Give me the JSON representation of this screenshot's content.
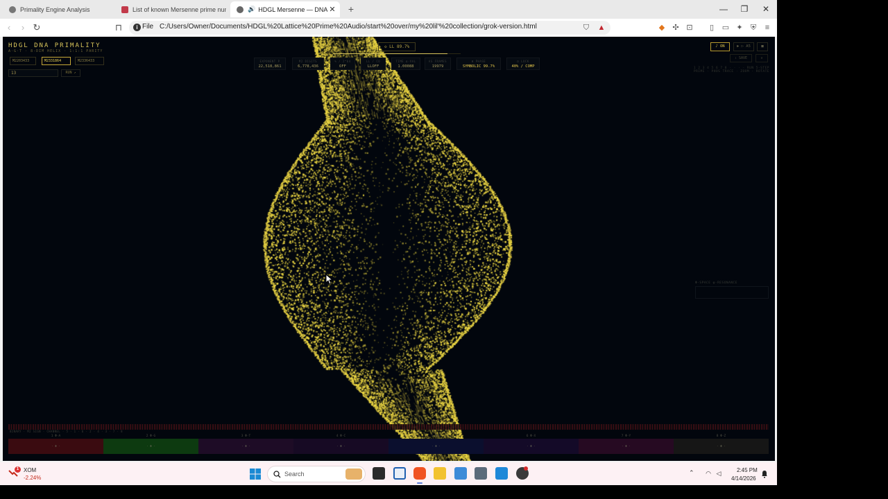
{
  "browser": {
    "tabs": [
      {
        "title": "Primality Engine Analysis",
        "icon": "globe-icon",
        "active": false
      },
      {
        "title": "List of known Mersenne prime numb",
        "icon": "wiki-icon",
        "active": false
      },
      {
        "title": "HDGL Mersenne — DNA Prim",
        "icon": "globe-icon",
        "active": true
      }
    ],
    "new_tab_label": "+",
    "controls": {
      "minimize": "—",
      "restore": "❐",
      "close": "✕"
    },
    "address": {
      "scheme_label": "File",
      "url": "C:/Users/Owner/Documents/HDGL%20Lattice%20Prime%20Audio/start%20over/my%20lil'%20collection/grok-version.html"
    }
  },
  "app": {
    "title": "HDGL DNA PRIMALITY",
    "subtitle": "A·G·T · 8-DIM HELIX · 1:1:1 PARITY",
    "presets": [
      "M2203433",
      "M2331864",
      "M2336433"
    ],
    "active_preset_index": 1,
    "exponent_input": "13",
    "run_label": "RUN ↗",
    "ll_badge": "◇ LL 89.7%",
    "ll_progress": 0.897,
    "stats": [
      {
        "label": "EXPONENT P",
        "value": "22,518,861"
      },
      {
        "label": "M2 DIGITS",
        "value": "6,778,436"
      },
      {
        "label": "% / 2^64",
        "value": "OFF"
      },
      {
        "label": "LL / CO",
        "value": "LLOFF"
      },
      {
        "label": "TIME Δ-VAL",
        "value": "1.00088"
      },
      {
        "label": "AS FRAMES",
        "value": "19979"
      },
      {
        "label": "Φ PHASE",
        "value": "SYMBOLIC 99.7%"
      },
      {
        "label": "Ω LOCK",
        "value": "40% / COMP"
      }
    ],
    "controls": [
      {
        "label": "♪ ON",
        "on": true
      },
      {
        "label": "▶ ▷ A5",
        "on": false
      },
      {
        "label": "■",
        "on": false
      }
    ],
    "controls2": [
      {
        "label": "⇩ SAVE"
      },
      {
        "label": "✕"
      }
    ],
    "hint_line1": "1 2 3 4 5 6 7 8 · · · · RUN 5-STEP",
    "hint_line2": "PRIME · PHOS TRACE · ZOOM · ROTATE",
    "resonance_label": "Φ-SPACE φ-RESONANCE",
    "strip_caption": "BINARY · M2 SIGN · CHANNEL · 5 · 1 · 6 · 2 · 4 · 3 · 7 · 8",
    "channels": [
      {
        "label": "1 Φ·A",
        "value": "· Φ ·",
        "color": "#3a0b10"
      },
      {
        "label": "2 Φ·G",
        "value": "· Φ ·",
        "color": "#0d3a10"
      },
      {
        "label": "3 Φ·T",
        "value": "· Φ ·",
        "color": "#1e0c26"
      },
      {
        "label": "4 Φ·C",
        "value": "· Φ ·",
        "color": "#170a24"
      },
      {
        "label": "5 Φ·U",
        "value": "· Φ ·",
        "color": "#0b0f2e"
      },
      {
        "label": "6 Φ·X",
        "value": "· Φ ·",
        "color": "#140a28"
      },
      {
        "label": "7 Φ·Y",
        "value": "· Φ ·",
        "color": "#260a22"
      },
      {
        "label": "8 Φ·Z",
        "value": "· Φ ·",
        "color": "#161616"
      }
    ],
    "accent_color": "#e9d443"
  },
  "taskbar": {
    "stock": {
      "badge": "1",
      "name": "XOM",
      "change": "-2.24%"
    },
    "search_placeholder": "Search",
    "apps": [
      "files-icon",
      "terminal-icon",
      "brave-icon",
      "explorer-icon",
      "notepad-icon",
      "calculator-icon",
      "vscode-icon",
      "obs-icon"
    ],
    "clock_time": "2:45 PM",
    "clock_date": "4/14/2026"
  }
}
